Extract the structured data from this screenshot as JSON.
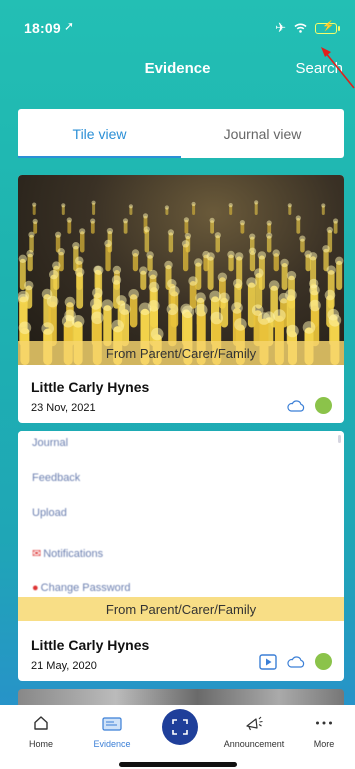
{
  "status_bar": {
    "time": "18:09",
    "location_icon": "location-arrow-icon",
    "icons": [
      "airplane-icon",
      "wifi-icon",
      "battery-charging-icon"
    ]
  },
  "header": {
    "title": "Evidence",
    "search_label": "Search"
  },
  "tabs": [
    {
      "label": "Tile view",
      "active": true
    },
    {
      "label": "Journal view",
      "active": false
    }
  ],
  "cards": [
    {
      "source": "From Parent/Carer/Family",
      "name": "Little Carly Hynes",
      "date": "23 Nov, 2021",
      "icons": [
        "cloud-icon"
      ],
      "status_color": "#8bc34a"
    },
    {
      "source": "From Parent/Carer/Family",
      "name": "Little Carly Hynes",
      "date": "21 May, 2020",
      "icons": [
        "video-play-icon",
        "cloud-icon"
      ],
      "status_color": "#8bc34a",
      "preview_menu": [
        "Journal",
        "Feedback",
        "Upload",
        "Notifications",
        "Change Password"
      ]
    }
  ],
  "bottom_nav": {
    "items": [
      {
        "label": "Home",
        "icon": "home-icon",
        "active": false
      },
      {
        "label": "Evidence",
        "icon": "evidence-icon",
        "active": true
      },
      {
        "label": "Announcement",
        "icon": "megaphone-icon",
        "active": false
      },
      {
        "label": "More",
        "icon": "more-dots-icon",
        "active": false
      }
    ],
    "center_action_icon": "scan-icon"
  },
  "colors": {
    "accent": "#2b8fd6",
    "banner": "#f6d66e",
    "status_dot": "#8bc34a",
    "scan_button": "#1f3f9a",
    "annotation_arrow": "#e0201c"
  }
}
